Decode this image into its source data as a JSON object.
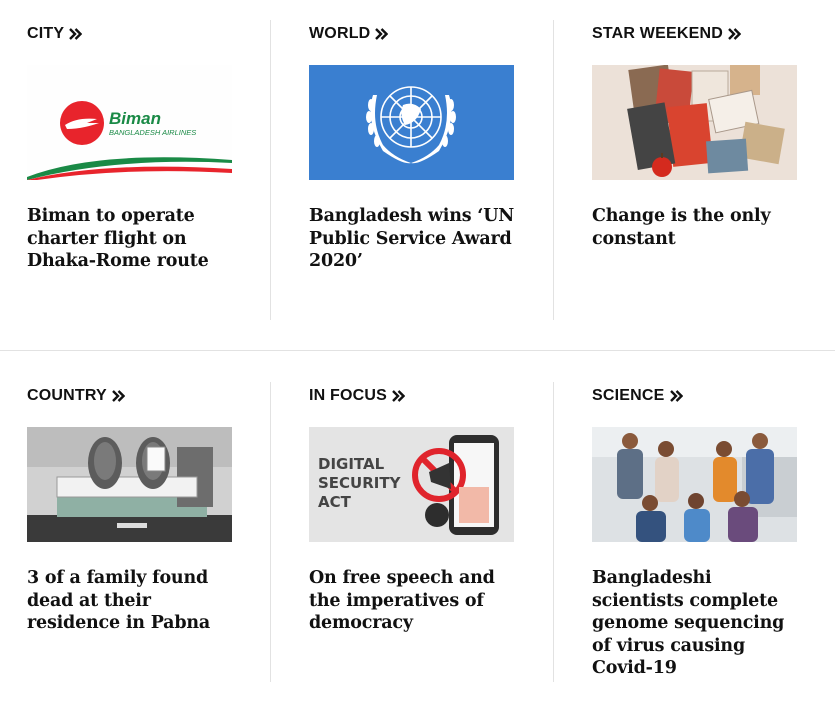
{
  "sections": [
    {
      "label": "CITY",
      "headline": "Biman to operate charter flight on Dhaka-Rome route",
      "image": "biman-bangladesh-airlines-logo",
      "logo_text": "Biman",
      "logo_subtext": "BANGLADESH AIRLINES"
    },
    {
      "label": "WORLD",
      "headline": "Bangladesh wins ‘UN Public Service Award 2020’",
      "image": "united-nations-emblem"
    },
    {
      "label": "STAR WEEKEND",
      "headline": "Change is the only constant",
      "image": "magazine-collage"
    },
    {
      "label": "COUNTRY",
      "headline": "3 of a family found dead at their residence in Pabna",
      "image": "morgue-illustration"
    },
    {
      "label": "IN FOCUS",
      "headline": "On free speech and the imperatives of democracy",
      "image": "digital-security-act-illustration",
      "graphic_text": [
        "DIGITAL",
        "SECURITY",
        "ACT"
      ]
    },
    {
      "label": "SCIENCE",
      "headline": "Bangladeshi scientists complete genome sequencing of virus causing Covid-19",
      "image": "scientists-group-photo"
    }
  ],
  "colors": {
    "text": "#111111",
    "divider": "#e2e2e2",
    "un_blue": "#3a7fd0",
    "biman_red": "#e8242c",
    "biman_green": "#1a8a46"
  }
}
